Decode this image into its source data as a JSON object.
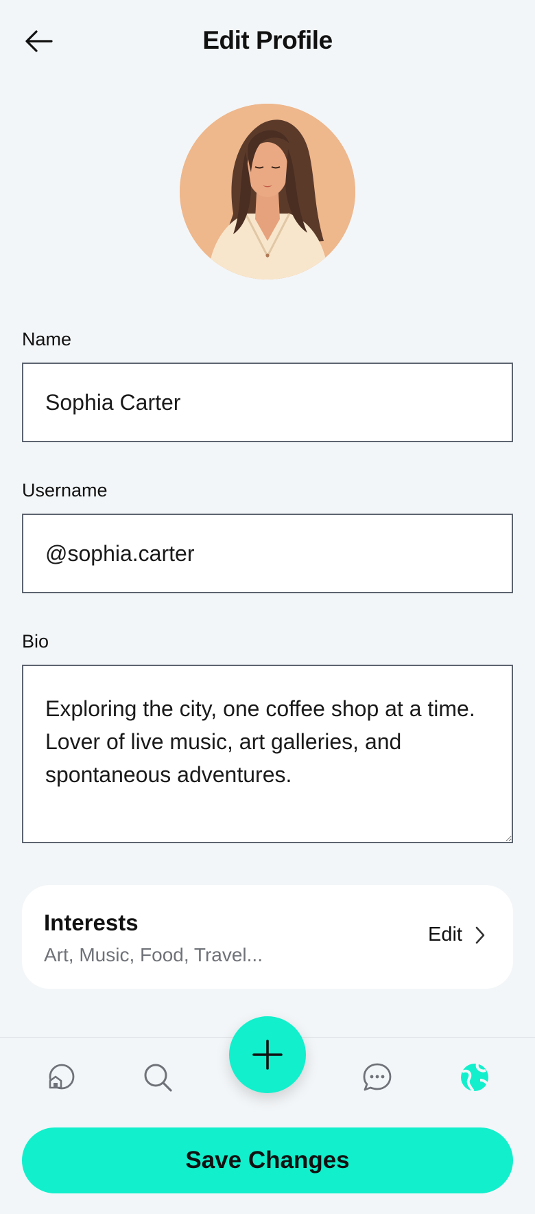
{
  "header": {
    "title": "Edit Profile",
    "back_icon": "arrow-left-icon"
  },
  "profile": {
    "avatar_icon": "avatar"
  },
  "form": {
    "name_label": "Name",
    "name_value": "Sophia Carter",
    "username_label": "Username",
    "username_value": "@sophia.carter",
    "bio_label": "Bio",
    "bio_value": "Exploring the city, one coffee shop at a time. Lover of live music, art galleries, and spontaneous adventures."
  },
  "interests": {
    "title": "Interests",
    "list": "Art, Music, Food, Travel...",
    "edit_label": "Edit",
    "chevron_icon": "chevron-right-icon"
  },
  "nav": {
    "items": [
      {
        "name": "home",
        "icon": "home-icon",
        "active": false
      },
      {
        "name": "search",
        "icon": "search-icon",
        "active": false
      },
      {
        "name": "create",
        "icon": "plus-icon",
        "active": false
      },
      {
        "name": "messages",
        "icon": "chat-icon",
        "active": false
      },
      {
        "name": "profile",
        "icon": "globe-icon",
        "active": true
      }
    ]
  },
  "footer": {
    "save_label": "Save Changes"
  },
  "colors": {
    "accent": "#12efcc",
    "background": "#f3f6f8",
    "input_border": "#5d6470",
    "muted_text": "#6f7278"
  }
}
